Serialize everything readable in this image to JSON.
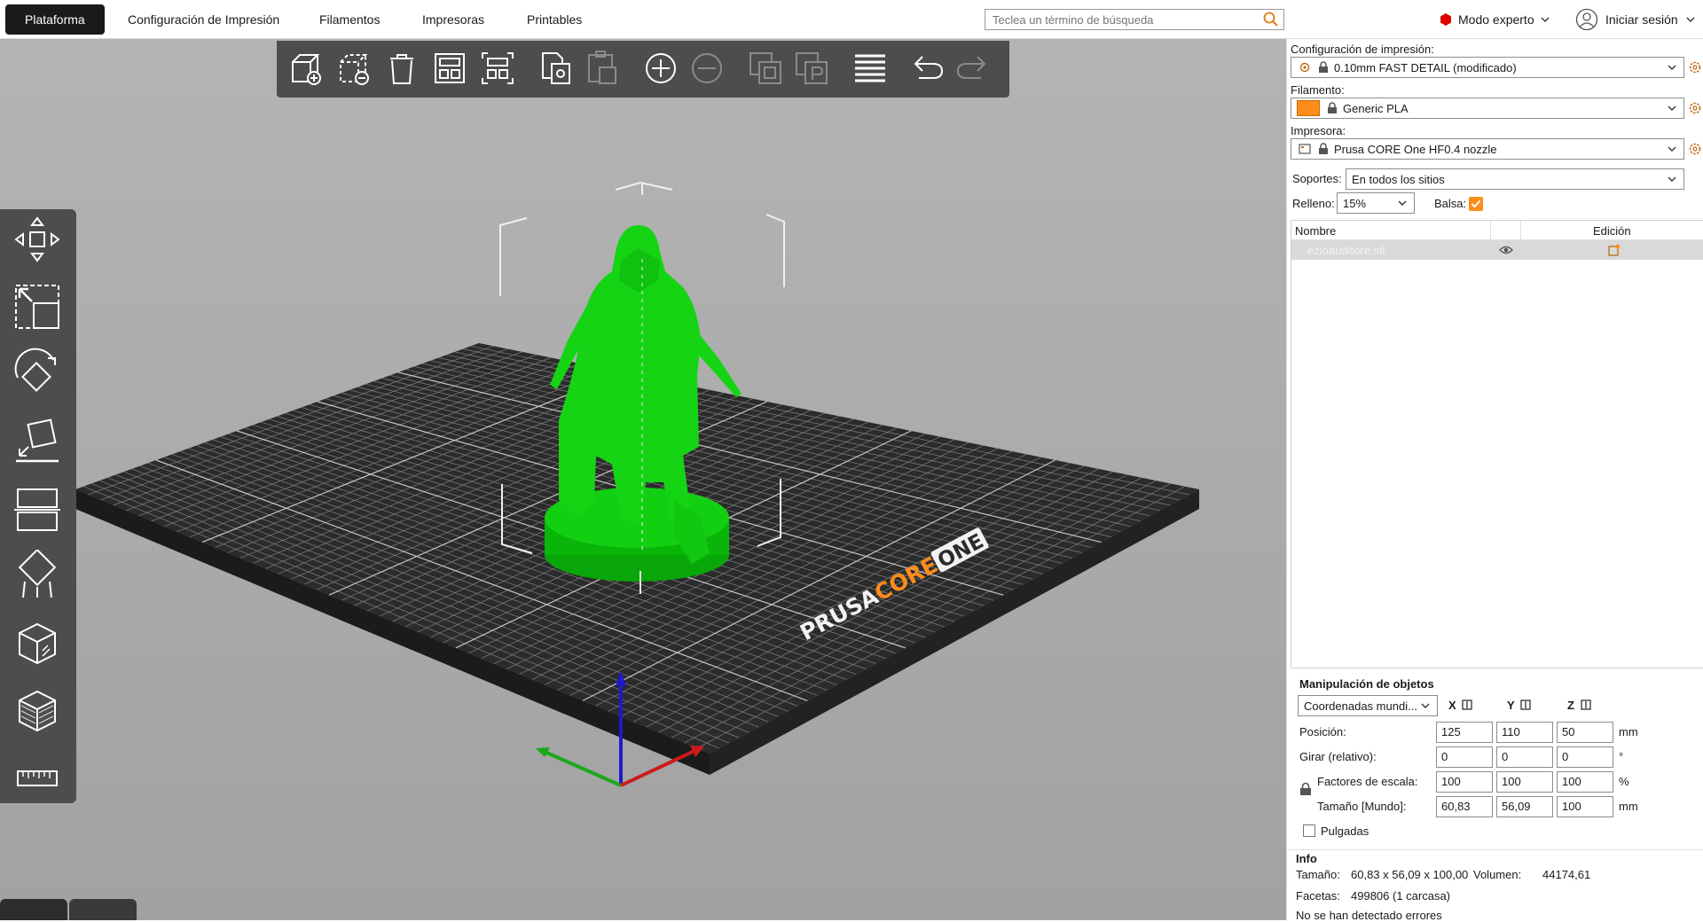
{
  "tabs": [
    "Plataforma",
    "Configuración de Impresión",
    "Filamentos",
    "Impresoras",
    "Printables"
  ],
  "active_tab": "Plataforma",
  "search": {
    "placeholder": "Teclea un término de búsqueda"
  },
  "mode": {
    "label": "Modo experto",
    "color": "#e00000"
  },
  "login": {
    "label": "Iniciar sesión"
  },
  "colors": {
    "accent": "#ff8c1a",
    "model": "#0fd20f",
    "bed": "#2b2b2b",
    "toolbar": "#4d4d4d"
  },
  "toolbar_icons": [
    "add-icon",
    "delete-selection-icon",
    "delete-all-icon",
    "arrange-icon",
    "arrange-selection-icon",
    "copy-icon",
    "paste-icon",
    "add-instance-icon",
    "remove-instance-icon",
    "split-objects-icon",
    "split-parts-icon",
    "layers-editing-icon",
    "undo-icon",
    "redo-icon"
  ],
  "left_tools": [
    "move-icon",
    "scale-icon",
    "rotate-icon",
    "place-on-face-icon",
    "cut-icon",
    "supports-icon",
    "seam-icon",
    "fuzzy-skin-icon",
    "measure-icon"
  ],
  "bed_logo": {
    "text1": "PRUSA",
    "text2": "CORE",
    "text3": "ONE"
  },
  "panel": {
    "print_settings_label": "Configuración de impresión:",
    "print_settings_value": "0.10mm FAST DETAIL (modificado)",
    "filament_label": "Filamento:",
    "filament_value": "Generic PLA",
    "printer_label": "Impresora:",
    "printer_value": "Prusa CORE One HF0.4 nozzle",
    "supports_label": "Soportes:",
    "supports_value": "En todos los sitios",
    "infill_label": "Relleno:",
    "infill_value": "15%",
    "brim_label": "Balsa:",
    "brim_checked": true
  },
  "object_list": {
    "col_name": "Nombre",
    "col_edit": "Edición",
    "rows": [
      {
        "name": "ezioauditore.stl"
      }
    ]
  },
  "manipulation": {
    "title": "Manipulación de objetos",
    "coord_select": "Coordenadas mundi...",
    "axes": [
      "X",
      "Y",
      "Z"
    ],
    "position_label": "Posición:",
    "position": [
      "125",
      "110",
      "50"
    ],
    "position_unit": "mm",
    "rotation_label": "Girar (relativo):",
    "rotation": [
      "0",
      "0",
      "0"
    ],
    "rotation_unit": "°",
    "scale_label": "Factores de escala:",
    "scale": [
      "100",
      "100",
      "100"
    ],
    "scale_unit": "%",
    "size_label": "Tamaño [Mundo]:",
    "size": [
      "60,83",
      "56,09",
      "100"
    ],
    "size_unit": "mm",
    "inches_label": "Pulgadas"
  },
  "info": {
    "title": "Info",
    "size_label": "Tamaño:",
    "size_value": "60,83 x 56,09 x 100,00",
    "volume_label": "Volumen:",
    "volume_value": "44174,61",
    "facets_label": "Facetas:",
    "facets_value": "499806 (1 carcasa)",
    "errors": "No se han detectado errores"
  }
}
